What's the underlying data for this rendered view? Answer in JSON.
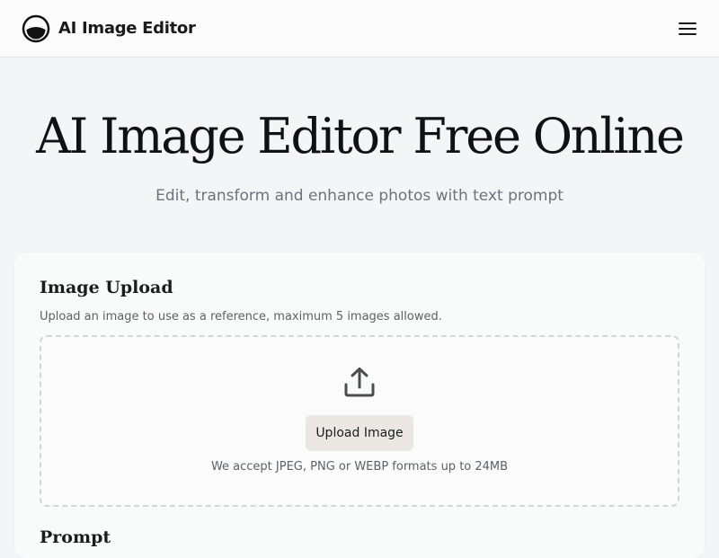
{
  "header": {
    "brand_name": "AI Image Editor",
    "logo_icon": "half-circle-logo-icon",
    "menu_icon": "hamburger-menu-icon"
  },
  "hero": {
    "title": "AI Image Editor Free Online",
    "subtitle": "Edit, transform and enhance photos with text prompt"
  },
  "image_upload": {
    "title": "Image Upload",
    "description": "Upload an image to use as a reference, maximum 5 images allowed.",
    "upload_icon": "upload-tray-icon",
    "button_label": "Upload Image",
    "formats_note": "We accept JPEG, PNG or WEBP formats up to 24MB"
  },
  "prompt": {
    "title": "Prompt"
  },
  "colors": {
    "page_background": "#f4f5f6",
    "header_background": "#fbfbfb",
    "upload_button_background": "#ebe8e4",
    "text_primary": "#0f1114",
    "text_muted": "#6e7278"
  }
}
